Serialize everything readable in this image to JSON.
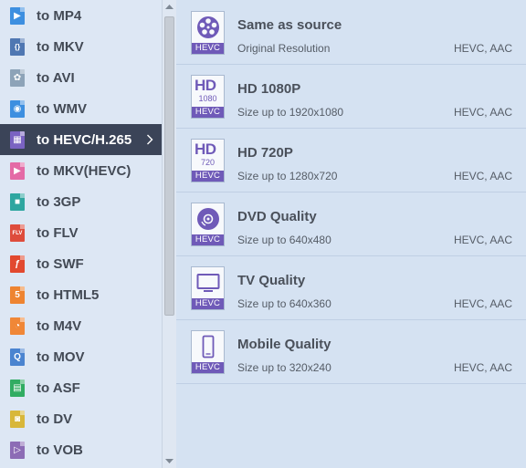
{
  "formats": [
    {
      "label": "to MP4",
      "icon": "mp4-file-icon",
      "color": "#3d8fe0",
      "glyph": "▶"
    },
    {
      "label": "to MKV",
      "icon": "mkv-file-icon",
      "color": "#4f77b2",
      "glyph": "{}"
    },
    {
      "label": "to AVI",
      "icon": "avi-file-icon",
      "color": "#8da3b8",
      "glyph": "✿"
    },
    {
      "label": "to WMV",
      "icon": "wmv-file-icon",
      "color": "#3d8fe0",
      "glyph": "◉"
    },
    {
      "label": "to HEVC/H.265",
      "icon": "hevc-file-icon",
      "color": "#7a63c2",
      "glyph": "▦",
      "selected": true
    },
    {
      "label": "to MKV(HEVC)",
      "icon": "mkv-hevc-file-icon",
      "color": "#e46aa6",
      "glyph": "▶"
    },
    {
      "label": "to 3GP",
      "icon": "3gp-file-icon",
      "color": "#2ea6a0",
      "glyph": "■"
    },
    {
      "label": "to FLV",
      "icon": "flv-file-icon",
      "color": "#de4c3c",
      "glyph": "FLV"
    },
    {
      "label": "to SWF",
      "icon": "swf-file-icon",
      "color": "#e2492f",
      "glyph": "ƒ"
    },
    {
      "label": "to HTML5",
      "icon": "html5-file-icon",
      "color": "#ee8431",
      "glyph": "5"
    },
    {
      "label": "to M4V",
      "icon": "m4v-file-icon",
      "color": "#f08737",
      "glyph": "◔"
    },
    {
      "label": "to MOV",
      "icon": "mov-file-icon",
      "color": "#4b84d0",
      "glyph": "Q"
    },
    {
      "label": "to ASF",
      "icon": "asf-file-icon",
      "color": "#31ac62",
      "glyph": "▤"
    },
    {
      "label": "to DV",
      "icon": "dv-file-icon",
      "color": "#d8b73a",
      "glyph": "◙"
    },
    {
      "label": "to VOB",
      "icon": "vob-file-icon",
      "color": "#8c6cb5",
      "glyph": "▷"
    }
  ],
  "presets": [
    {
      "title": "Same as source",
      "subtitle": "Original Resolution",
      "codec": "HEVC, AAC",
      "tag": "HEVC",
      "art": "reel",
      "name": "same-as-source"
    },
    {
      "title": "HD 1080P",
      "subtitle": "Size up to 1920x1080",
      "codec": "HEVC, AAC",
      "tag": "HEVC",
      "art": "hd",
      "hd_label": "HD",
      "hd_res": "1080",
      "name": "hd-1080p"
    },
    {
      "title": "HD 720P",
      "subtitle": "Size up to 1280x720",
      "codec": "HEVC, AAC",
      "tag": "HEVC",
      "art": "hd",
      "hd_label": "HD",
      "hd_res": "720",
      "name": "hd-720p"
    },
    {
      "title": "DVD Quality",
      "subtitle": "Size up to 640x480",
      "codec": "HEVC, AAC",
      "tag": "HEVC",
      "art": "disc",
      "name": "dvd-quality"
    },
    {
      "title": "TV Quality",
      "subtitle": "Size up to 640x360",
      "codec": "HEVC, AAC",
      "tag": "HEVC",
      "art": "tv",
      "name": "tv-quality"
    },
    {
      "title": "Mobile Quality",
      "subtitle": "Size up to 320x240",
      "codec": "HEVC, AAC",
      "tag": "HEVC",
      "art": "phone",
      "name": "mobile-quality"
    }
  ],
  "colors": {
    "accent": "#6f5ab8",
    "selected_bg": "#3b4458"
  }
}
